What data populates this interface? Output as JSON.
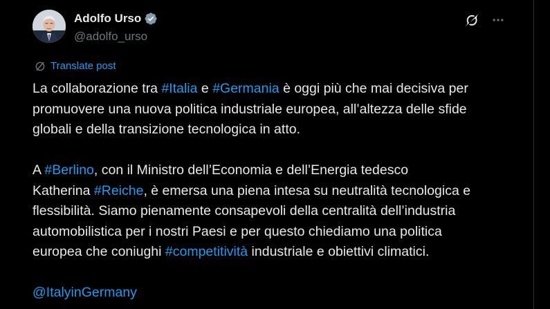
{
  "author": {
    "display_name": "Adolfo Urso",
    "handle": "@adolfo_urso",
    "verified": true
  },
  "actions": {
    "translate_label": "Translate post"
  },
  "tweet": {
    "line1": {
      "t1": "La collaborazione tra ",
      "tag1": "#Italia",
      "t2": " e ",
      "tag2": "#Germania",
      "t3": " è oggi più che mai decisiva per"
    },
    "line2": "promuovere una nuova politica industriale europea, all’altezza delle sfide",
    "line3": "globali e della transizione tecnologica in atto.",
    "line4": {
      "t1": "A ",
      "tag1": "#Berlino",
      "t2": ", con il Ministro dell’Economia e dell’Energia tedesco"
    },
    "line5": {
      "t1": "Katherina ",
      "tag1": "#Reiche",
      "t2": ", è emersa una piena intesa su neutralità tecnologica e"
    },
    "line6": "flessibilità. Siamo pienamente consapevoli della centralità dell’industria",
    "line7": "automobilistica per i nostri Paesi e per questo chiediamo una politica",
    "line8": {
      "t1": "europea che coniughi ",
      "tag1": "#competitività",
      "t2": " industriale e obiettivi climatici."
    },
    "mention": "@ItalyinGermany"
  },
  "colors": {
    "background": "#000000",
    "text": "#e7e9ea",
    "secondary": "#71767b",
    "link": "#1d9bf0",
    "verified": "#829aab"
  },
  "icons": {
    "verified": "verified-badge-icon",
    "grok": "grok-icon",
    "more": "more-dots-icon",
    "translate": "translate-icon"
  }
}
